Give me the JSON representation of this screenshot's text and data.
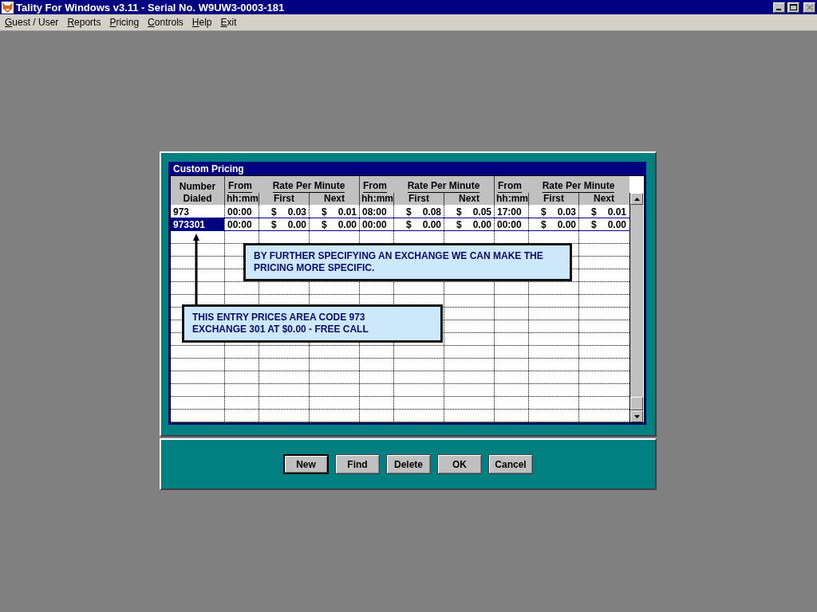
{
  "window": {
    "title": "Tality For Windows v3.11 - Serial No. W9UW3-0003-181"
  },
  "menu": [
    {
      "label": "Guest / User"
    },
    {
      "label": "Reports"
    },
    {
      "label": "Pricing"
    },
    {
      "label": "Controls"
    },
    {
      "label": "Help"
    },
    {
      "label": "Exit"
    }
  ],
  "dialog": {
    "title": "Custom Pricing",
    "table": {
      "number_header": [
        "Number",
        "Dialed"
      ],
      "period_headers": [
        {
          "from": "From",
          "unit": "hh:mm",
          "rate": "Rate Per Minute",
          "first": "First",
          "next": "Next"
        },
        {
          "from": "From",
          "unit": "hh:mm",
          "rate": "Rate Per Minute",
          "first": "First",
          "next": "Next"
        },
        {
          "from": "From",
          "unit": "hh:mm",
          "rate": "Rate Per Minute",
          "first": "First",
          "next": "Next"
        }
      ],
      "rows": [
        {
          "number": "973",
          "selected": false,
          "periods": [
            {
              "from": "00:00",
              "first": [
                "$",
                "0.03"
              ],
              "next": [
                "$",
                "0.01"
              ]
            },
            {
              "from": "08:00",
              "first": [
                "$",
                "0.08"
              ],
              "next": [
                "$",
                "0.05"
              ]
            },
            {
              "from": "17:00",
              "first": [
                "$",
                "0.03"
              ],
              "next": [
                "$",
                "0.01"
              ]
            }
          ]
        },
        {
          "number": "973301",
          "selected": true,
          "periods": [
            {
              "from": "00:00",
              "first": [
                "$",
                "0.00"
              ],
              "next": [
                "$",
                "0.00"
              ]
            },
            {
              "from": "00:00",
              "first": [
                "$",
                "0.00"
              ],
              "next": [
                "$",
                "0.00"
              ]
            },
            {
              "from": "00:00",
              "first": [
                "$",
                "0.00"
              ],
              "next": [
                "$",
                "0.00"
              ]
            }
          ]
        }
      ]
    },
    "callouts": [
      {
        "lines": [
          "BY FURTHER SPECIFYING AN EXCHANGE WE CAN MAKE THE",
          "PRICING MORE SPECIFIC."
        ]
      },
      {
        "lines": [
          "THIS ENTRY PRICES AREA CODE 973",
          "EXCHANGE 301 AT $0.00 - FREE CALL"
        ]
      }
    ],
    "buttons": [
      {
        "label": "New",
        "default": true
      },
      {
        "label": "Find",
        "default": false
      },
      {
        "label": "Delete",
        "default": false
      },
      {
        "label": "OK",
        "default": false
      },
      {
        "label": "Cancel",
        "default": false
      }
    ]
  }
}
